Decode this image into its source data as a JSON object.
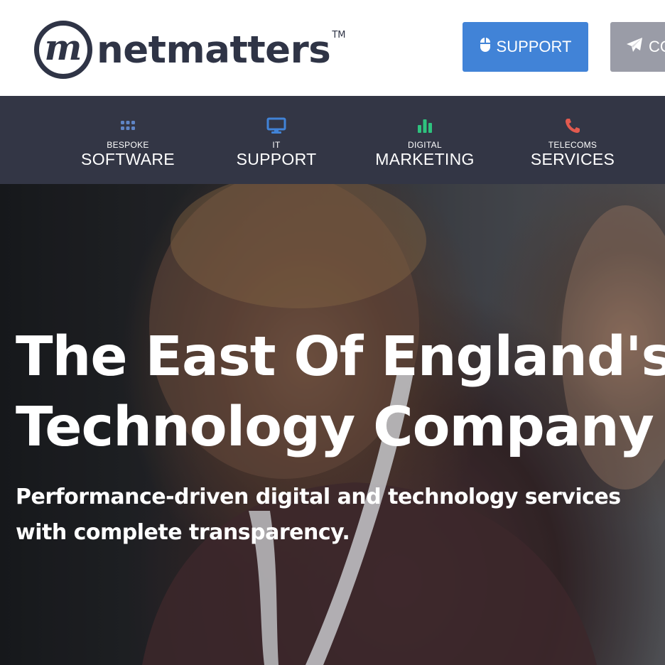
{
  "brand": {
    "logo_mark": "m",
    "name": "netmatters",
    "tm": "TM"
  },
  "header_buttons": {
    "support": {
      "label": "SUPPORT",
      "icon": "mouse-icon",
      "color": "#4183d7"
    },
    "contact": {
      "label": "CONTACT",
      "icon": "paper-plane-icon",
      "color": "#9a9ca7"
    }
  },
  "nav": {
    "items": [
      {
        "small": "BESPOKE",
        "big": "SOFTWARE",
        "icon": "grid-icon",
        "icon_color": "#5f85c6"
      },
      {
        "small": "IT",
        "big": "SUPPORT",
        "icon": "monitor-icon",
        "icon_color": "#4183d7"
      },
      {
        "small": "DIGITAL",
        "big": "MARKETING",
        "icon": "bar-chart-icon",
        "icon_color": "#2ec27e"
      },
      {
        "small": "TELECOMS",
        "big": "SERVICES",
        "icon": "phone-icon",
        "icon_color": "#e25a4f"
      }
    ]
  },
  "hero": {
    "title_line1": "The East Of England's Leading",
    "title_line2": "Technology Company",
    "subtitle_line1": "Performance-driven digital and technology services",
    "subtitle_line2": "with complete transparency."
  }
}
